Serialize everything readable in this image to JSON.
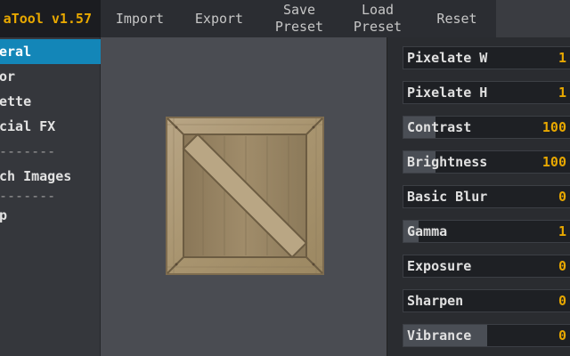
{
  "app": {
    "title": "aTool v1.57"
  },
  "toolbar": {
    "buttons": [
      {
        "label": "Import"
      },
      {
        "label": "Export"
      },
      {
        "label": "Save\nPreset"
      },
      {
        "label": "Load\nPreset"
      },
      {
        "label": "Reset"
      }
    ]
  },
  "sidebar": {
    "items": [
      {
        "label": "eral",
        "active": true
      },
      {
        "label": "or",
        "active": false
      },
      {
        "label": "ette",
        "active": false
      },
      {
        "label": "cial FX",
        "active": false
      },
      {
        "label": "-------",
        "active": false
      },
      {
        "label": "ch Images",
        "active": false
      },
      {
        "label": "-------",
        "active": false
      },
      {
        "label": "p",
        "active": false
      }
    ]
  },
  "panel": {
    "sliders": [
      {
        "label": "Pixelate W",
        "value": "1",
        "fill": 0.0
      },
      {
        "label": "Pixelate H",
        "value": "1",
        "fill": 0.0
      },
      {
        "label": "Contrast",
        "value": "100",
        "fill": 0.19
      },
      {
        "label": "Brightness",
        "value": "100",
        "fill": 0.19
      },
      {
        "label": "Basic Blur",
        "value": "0",
        "fill": 0.0
      },
      {
        "label": "Gamma",
        "value": "1",
        "fill": 0.09
      },
      {
        "label": "Exposure",
        "value": "0",
        "fill": 0.0
      },
      {
        "label": "Sharpen",
        "value": "0",
        "fill": 0.0
      },
      {
        "label": "Vibrance",
        "value": "0",
        "fill": 0.5
      }
    ]
  },
  "colors": {
    "accent": "#e8a800",
    "active_tab": "#1386b8"
  }
}
